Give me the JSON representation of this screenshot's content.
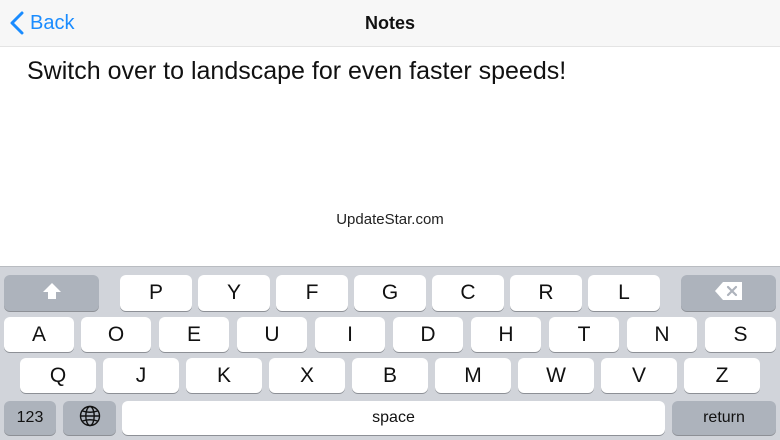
{
  "navbar": {
    "back_label": "Back",
    "title": "Notes",
    "back_icon": "chevron-left-icon"
  },
  "note": {
    "text": "Switch over to landscape for even faster speeds!"
  },
  "watermark": "UpdateStar.com",
  "keyboard": {
    "row1": [
      "P",
      "Y",
      "F",
      "G",
      "C",
      "R",
      "L"
    ],
    "row2": [
      "A",
      "O",
      "E",
      "U",
      "I",
      "D",
      "H",
      "T",
      "N",
      "S"
    ],
    "row3": [
      "Q",
      "J",
      "K",
      "X",
      "B",
      "M",
      "W",
      "V",
      "Z"
    ],
    "numbers_label": "123",
    "space_label": "space",
    "return_label": "return",
    "shift_icon": "shift-arrow-icon",
    "delete_icon": "backspace-icon",
    "globe_icon": "globe-icon"
  },
  "colors": {
    "accent": "#1a8cff",
    "keyboard_bg": "#d1d4da",
    "modifier_key": "#adb3bc"
  }
}
